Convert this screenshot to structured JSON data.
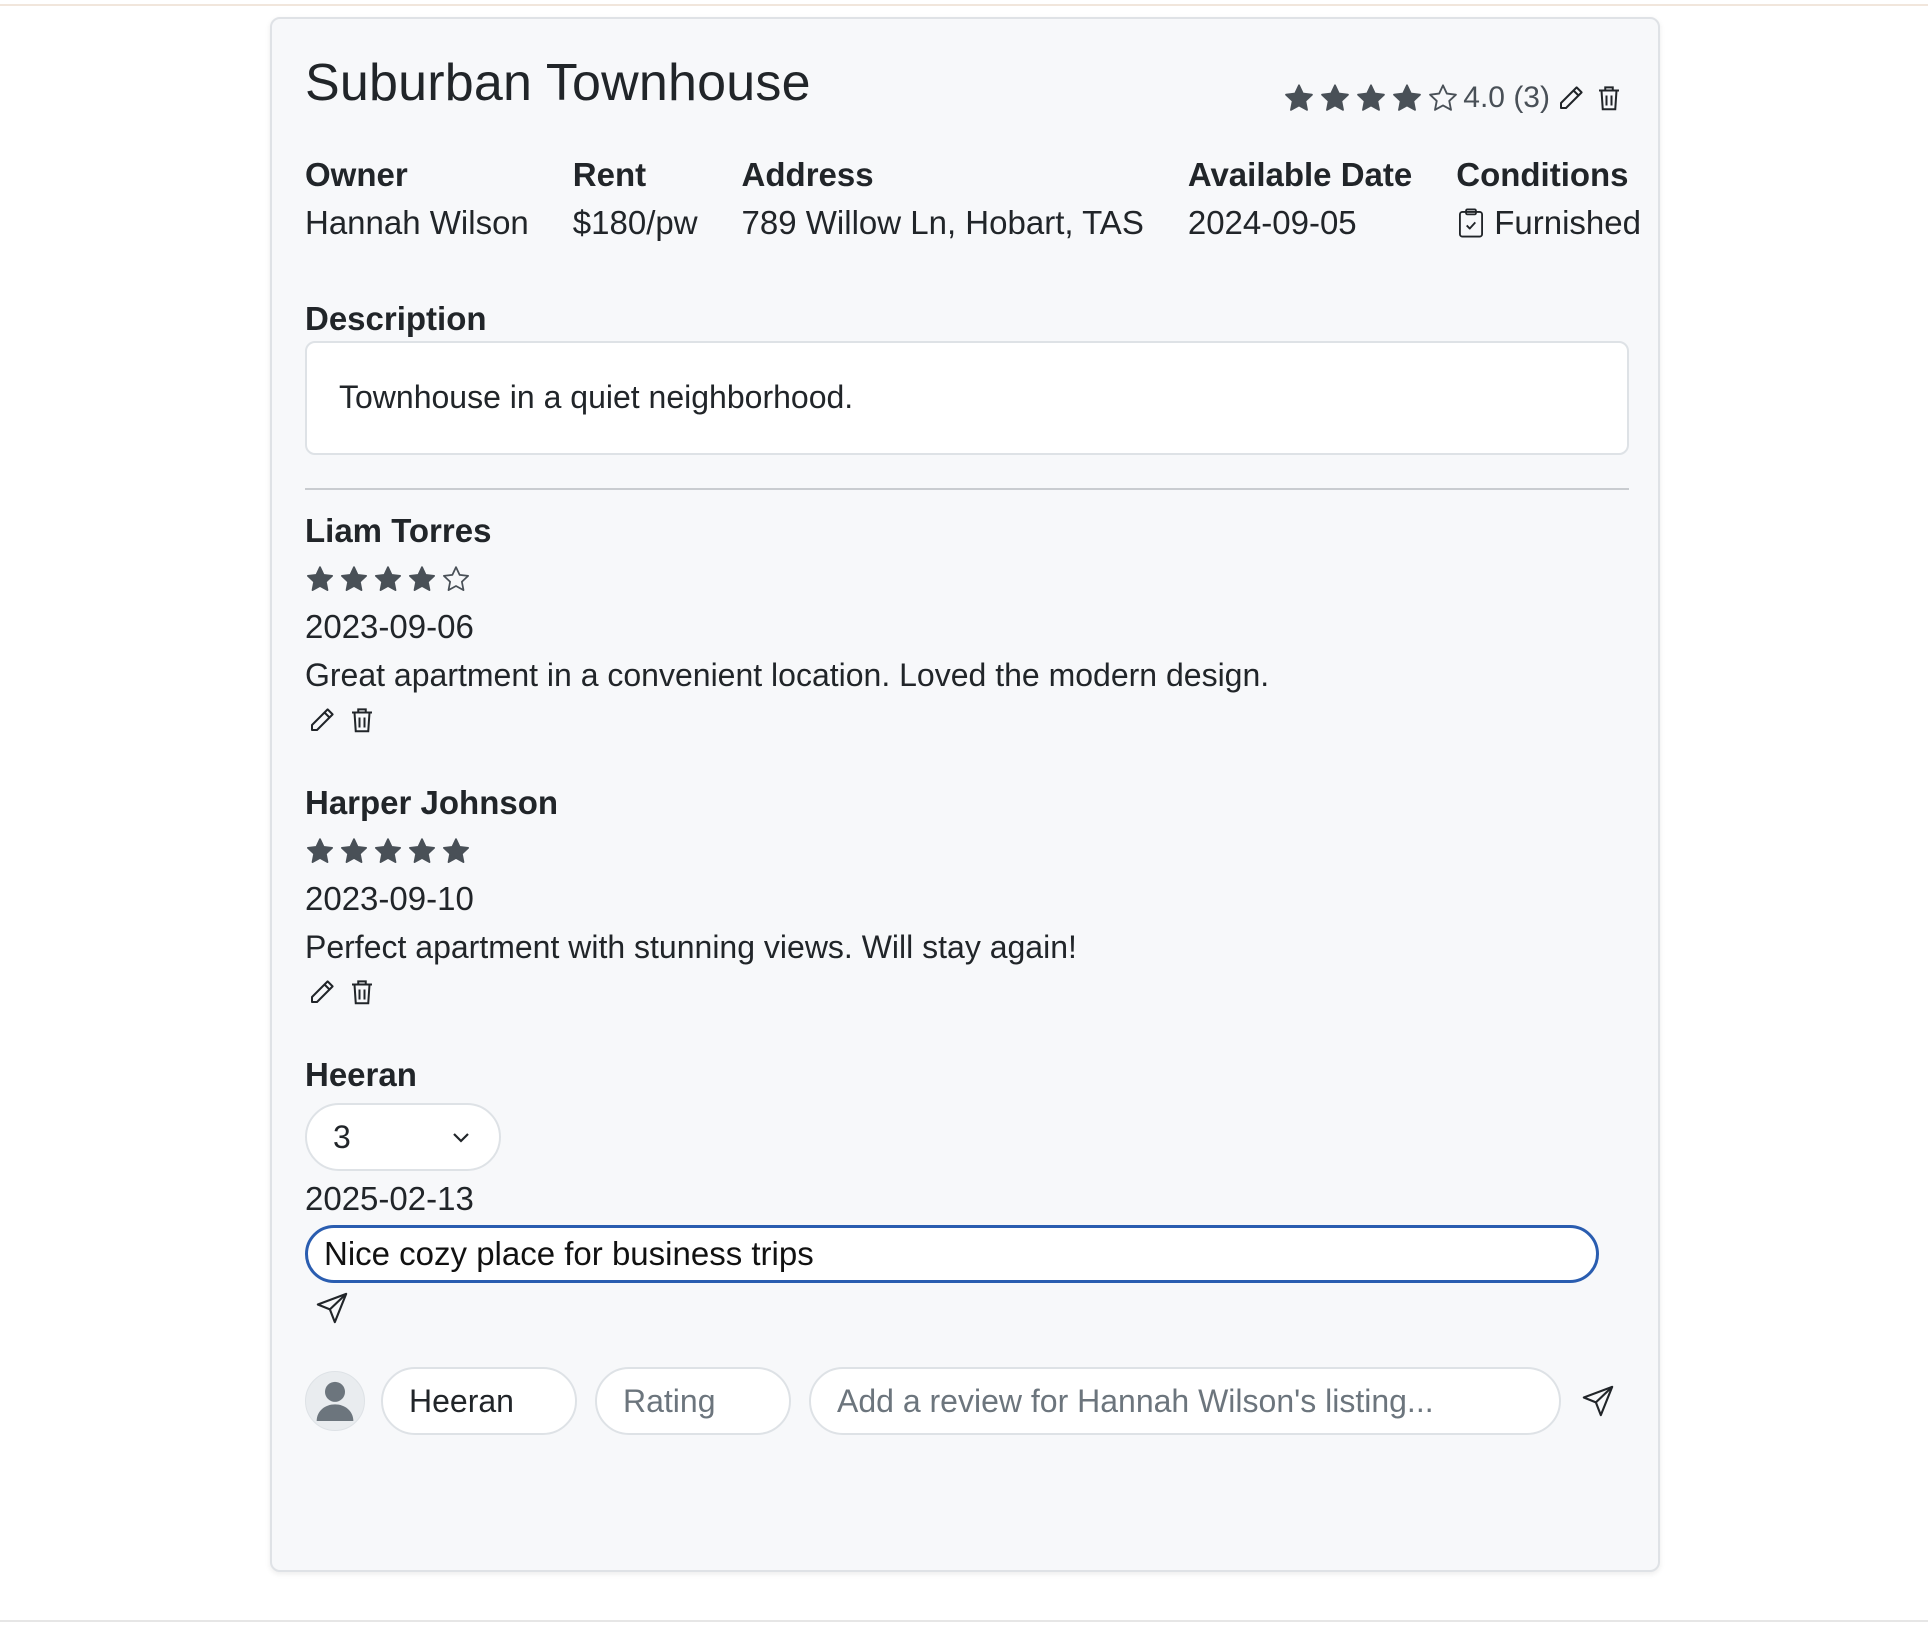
{
  "listing": {
    "title": "Suburban Townhouse",
    "rating_text": "4.0 (3)",
    "rating_value": 4
  },
  "info": {
    "owner_label": "Owner",
    "owner_value": "Hannah Wilson",
    "rent_label": "Rent",
    "rent_value": "$180/pw",
    "address_label": "Address",
    "address_value": "789 Willow Ln, Hobart, TAS",
    "date_label": "Available Date",
    "date_value": "2024-09-05",
    "conditions_label": "Conditions",
    "conditions_value": "Furnished",
    "conditions_icon": "clipboard-check-icon"
  },
  "description": {
    "label": "Description",
    "text": "Townhouse in a quiet neighborhood."
  },
  "reviews": [
    {
      "author": "Liam Torres",
      "rating": 4,
      "date": "2023-09-06",
      "text": "Great apartment in a convenient location. Loved the modern design."
    },
    {
      "author": "Harper Johnson",
      "rating": 5,
      "date": "2023-09-10",
      "text": "Perfect apartment with stunning views. Will stay again!"
    }
  ],
  "editing_review": {
    "author": "Heeran",
    "rating_selected": "3",
    "date": "2025-02-13",
    "text_value": "Nice cozy place for business trips"
  },
  "composer": {
    "name_value": "Heeran",
    "rating_placeholder": "Rating",
    "review_placeholder": "Add a review for Hannah Wilson's listing..."
  },
  "colors": {
    "star": "#495057",
    "focus_border": "#2a5db0",
    "card_bg": "#f7f8fa"
  }
}
